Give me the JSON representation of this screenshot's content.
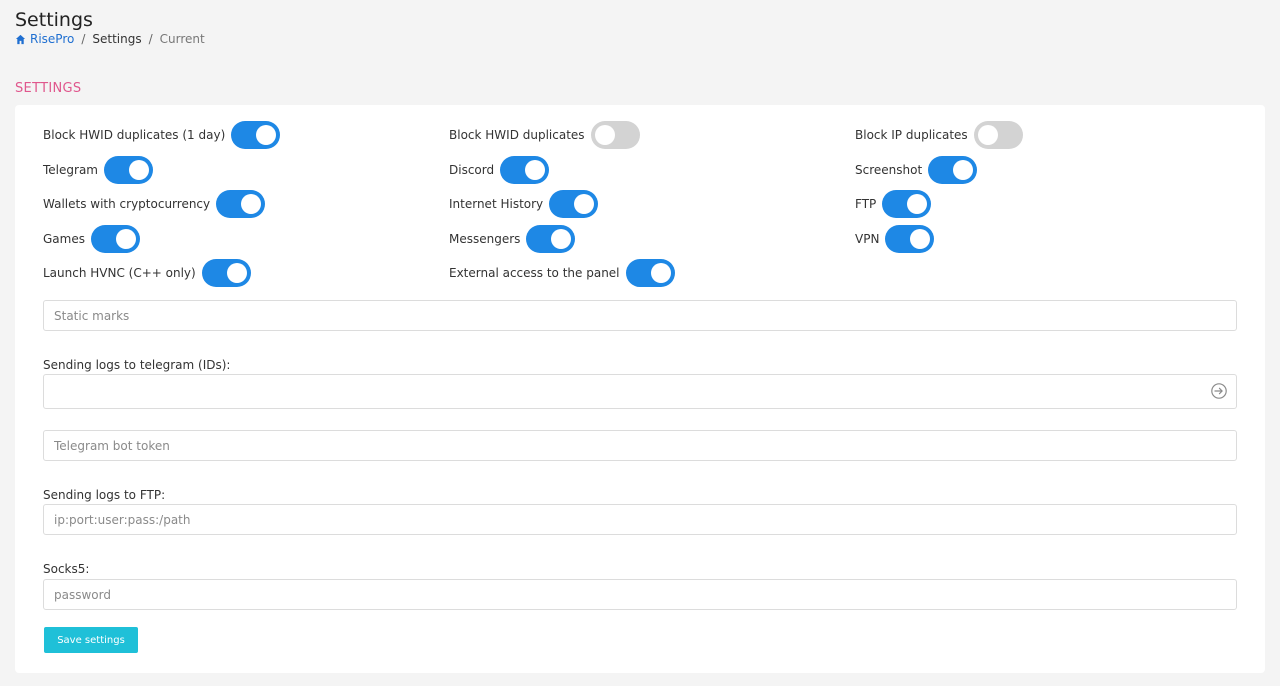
{
  "header": {
    "title": "Settings",
    "breadcrumb": {
      "home": "RisePro",
      "separator": "/",
      "middle": "Settings",
      "current": "Current"
    }
  },
  "section_title": "SETTINGS",
  "toggles": [
    {
      "label": "Block HWID duplicates (1 day)",
      "on": true
    },
    {
      "label": "Block HWID duplicates",
      "on": false
    },
    {
      "label": "Block IP duplicates",
      "on": false
    },
    {
      "label": "Telegram",
      "on": true
    },
    {
      "label": "Discord",
      "on": true
    },
    {
      "label": "Screenshot",
      "on": true
    },
    {
      "label": "Wallets with cryptocurrency",
      "on": true
    },
    {
      "label": "Internet History",
      "on": true
    },
    {
      "label": "FTP",
      "on": true
    },
    {
      "label": "Games",
      "on": true
    },
    {
      "label": "Messengers",
      "on": true
    },
    {
      "label": "VPN",
      "on": true
    },
    {
      "label": "Launch HVNC (C++ only)",
      "on": true
    },
    {
      "label": "External access to the panel",
      "on": true
    }
  ],
  "fields": {
    "static_marks": {
      "placeholder": "Static marks",
      "value": ""
    },
    "telegram_ids": {
      "label": "Sending logs to telegram (IDs):",
      "value": ""
    },
    "bot_token": {
      "placeholder": "Telegram bot token",
      "value": ""
    },
    "ftp": {
      "label": "Sending logs to FTP:",
      "placeholder": "ip:port:user:pass:/path",
      "value": ""
    },
    "socks5": {
      "label": "Socks5:",
      "placeholder": "password",
      "value": ""
    }
  },
  "save_button": "Save settings",
  "colors": {
    "accent": "#1e88e5",
    "toggle_off": "#d3d3d3",
    "section_title": "#e0578d",
    "save_button": "#1fc0d8",
    "breadcrumb_link": "#1f6fd1"
  }
}
